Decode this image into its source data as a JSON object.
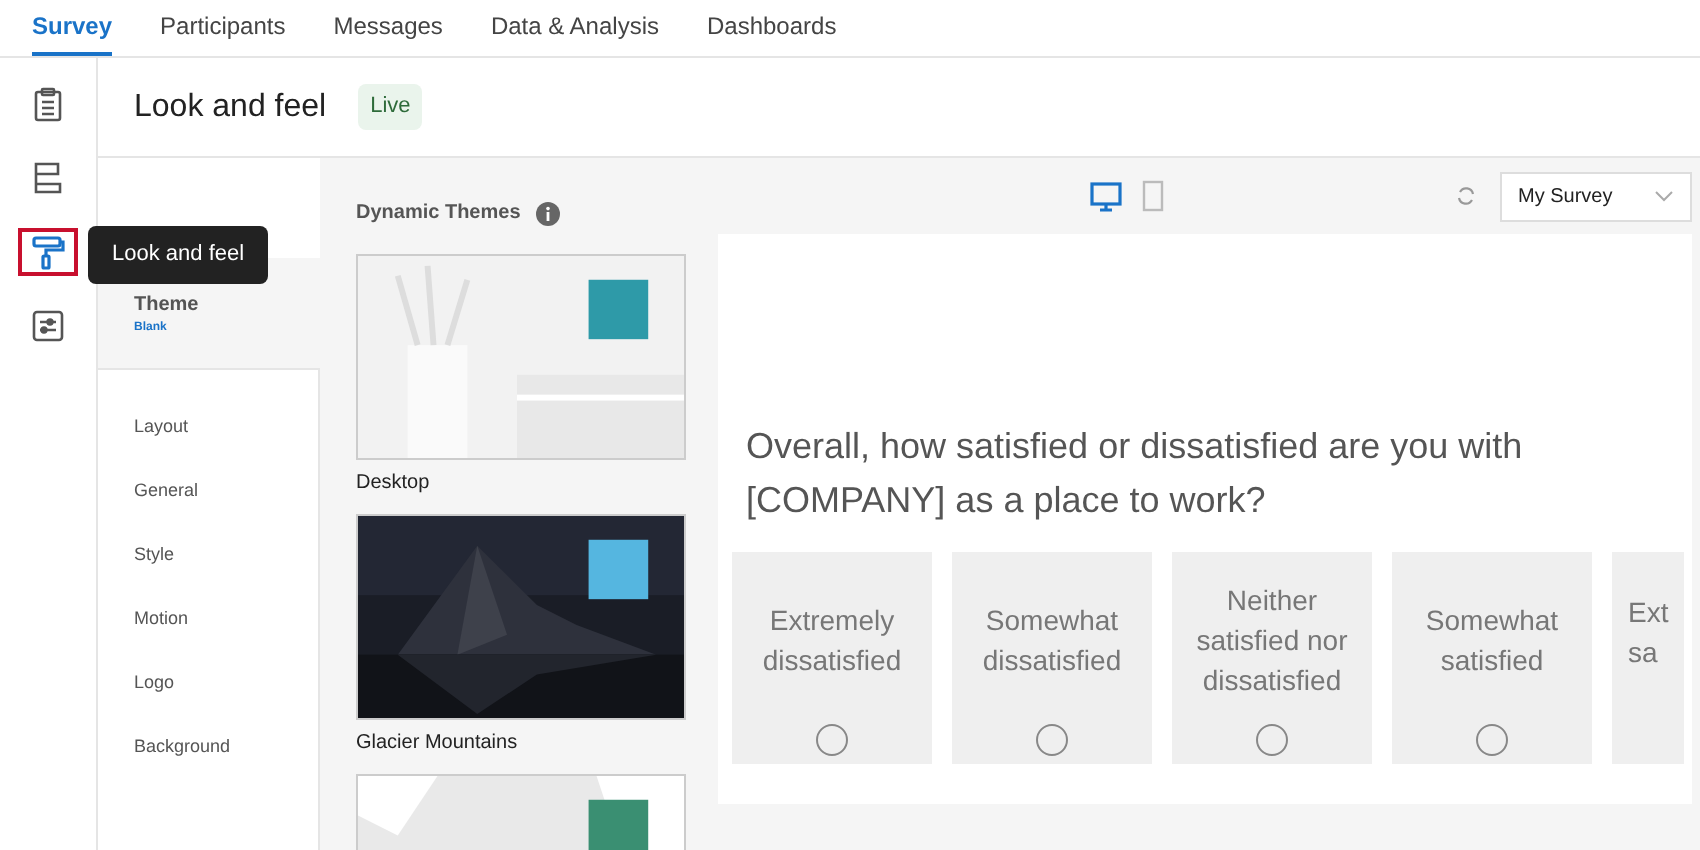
{
  "tabs": [
    {
      "label": "Survey",
      "selected": true
    },
    {
      "label": "Participants",
      "selected": false
    },
    {
      "label": "Messages",
      "selected": false
    },
    {
      "label": "Data & Analysis",
      "selected": false
    },
    {
      "label": "Dashboards",
      "selected": false
    }
  ],
  "rail": [
    {
      "kind": "clipboard",
      "selected": false
    },
    {
      "kind": "flow",
      "selected": false
    },
    {
      "kind": "roller",
      "selected": true
    },
    {
      "kind": "sliders",
      "selected": false
    }
  ],
  "tooltip": "Look and feel",
  "page": {
    "title": "Look and feel",
    "status": "Live"
  },
  "theme": {
    "label": "Theme",
    "value": "Blank"
  },
  "nav": [
    {
      "label": "Layout"
    },
    {
      "label": "General"
    },
    {
      "label": "Style"
    },
    {
      "label": "Motion"
    },
    {
      "label": "Logo"
    },
    {
      "label": "Background"
    }
  ],
  "themes_heading": "Dynamic Themes",
  "themes": [
    {
      "name": "Desktop",
      "kind": "light",
      "color": "#2e9aa8"
    },
    {
      "name": "Glacier Mountains",
      "kind": "dark",
      "color": "#55b6e0"
    },
    {
      "kind": "light",
      "color": "#3a8f72"
    }
  ],
  "preview": {
    "views": [
      {
        "kind": "desktop",
        "selected": true
      },
      {
        "kind": "mobile",
        "selected": false
      }
    ],
    "survey_select": "My Survey",
    "question": "Overall, how satisfied or dissatisfied are you with [COMPANY] as a place to work?",
    "options": [
      {
        "label": "Extremely dissatisfied",
        "selected": false
      },
      {
        "label": "Somewhat dissatisfied",
        "selected": false
      },
      {
        "label": "Neither satisfied nor dissatisfied",
        "selected": false
      },
      {
        "label": "Somewhat satisfied",
        "selected": false
      },
      {
        "lines": [
          "Ext",
          "sa"
        ]
      }
    ]
  }
}
